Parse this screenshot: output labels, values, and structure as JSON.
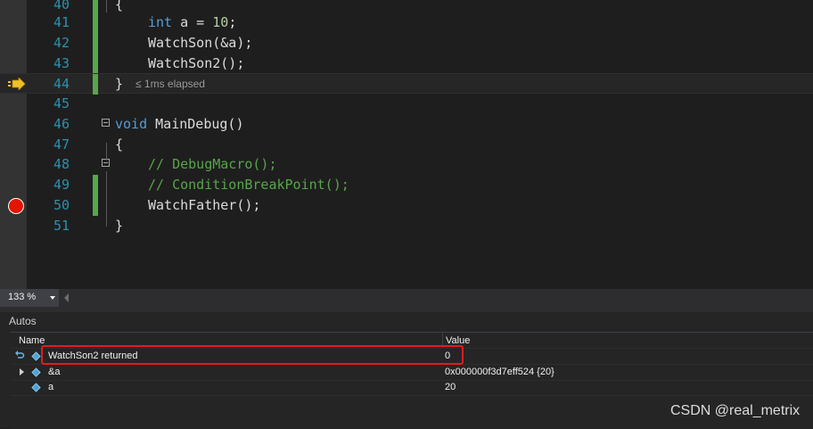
{
  "editor": {
    "lines": [
      {
        "num": "40",
        "code": "{"
      },
      {
        "num": "41",
        "code": "int a = 10;"
      },
      {
        "num": "42",
        "code": "WatchSon(&a);"
      },
      {
        "num": "43",
        "code": "WatchSon2();"
      },
      {
        "num": "44",
        "code": "}",
        "elapsed": "≤ 1ms elapsed"
      },
      {
        "num": "45",
        "code": ""
      },
      {
        "num": "46",
        "code": "void MainDebug()"
      },
      {
        "num": "47",
        "code": "{"
      },
      {
        "num": "48",
        "code": "// DebugMacro();"
      },
      {
        "num": "49",
        "code": "// ConditionBreakPoint();"
      },
      {
        "num": "50",
        "code": "WatchFather();"
      },
      {
        "num": "51",
        "code": "}"
      }
    ],
    "icons": {
      "current_statement": "instruction-pointer-icon",
      "breakpoint": "breakpoint-icon"
    },
    "colors": {
      "keyword": "#569cd6",
      "number": "#b5cea8",
      "comment": "#57a64a",
      "breakpoint": "#e51400",
      "change_bar": "#57a64a"
    }
  },
  "status": {
    "zoom": "133 %"
  },
  "autos": {
    "title": "Autos",
    "columns": {
      "name": "Name",
      "value": "Value"
    },
    "rows": [
      {
        "name": "WatchSon2 returned",
        "value": "0",
        "highlighted": true
      },
      {
        "name": "&a",
        "value": "0x000000f3d7eff524 {20}",
        "expandable": true
      },
      {
        "name": "a",
        "value": "20"
      }
    ]
  },
  "watermark": "CSDN @real_metrix"
}
